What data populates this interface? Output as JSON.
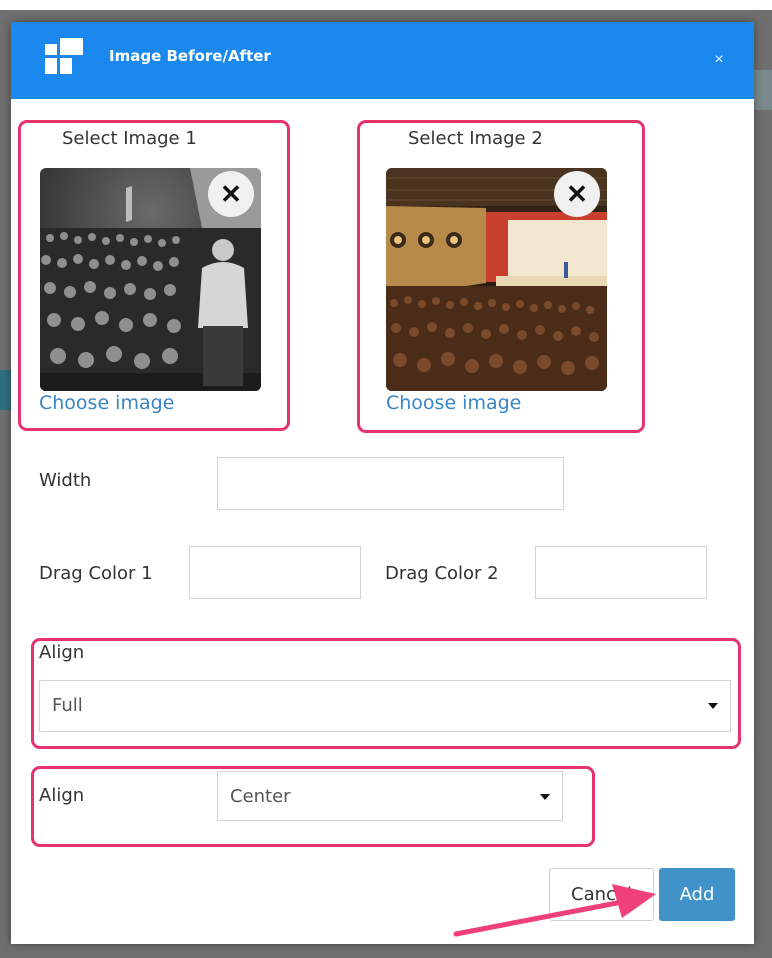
{
  "dialog": {
    "title": "Image Before/After",
    "close_glyph": "×",
    "icon": "grid-logo-icon"
  },
  "images": [
    {
      "label": "Select Image 1",
      "remove_glyph": "✕",
      "choose_label": "Choose image",
      "photo": "black-and-white speaker facing audience"
    },
    {
      "label": "Select Image 2",
      "remove_glyph": "✕",
      "choose_label": "Choose image",
      "photo": "theatre auditorium with lit stage"
    }
  ],
  "fields": {
    "width_label": "Width",
    "width_value": "",
    "drag_color_1_label": "Drag Color 1",
    "drag_color_1_value": "",
    "drag_color_2_label": "Drag Color 2",
    "drag_color_2_value": "",
    "align_full_label": "Align",
    "align_full_value": "Full",
    "align_center_label": "Align",
    "align_center_value": "Center"
  },
  "buttons": {
    "cancel": "Cancel",
    "add": "Add"
  },
  "colors": {
    "header": "#1a88ec",
    "highlight": "#e5336b",
    "link": "#3a85c4",
    "add_button": "#3f93c8"
  }
}
